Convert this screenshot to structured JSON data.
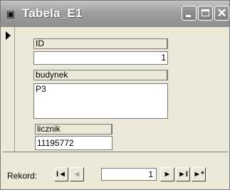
{
  "window": {
    "title": "Tabela_E1",
    "icons": {
      "system": "form-view-icon",
      "minimize": "minimize-icon",
      "maximize": "maximize-icon",
      "close": "close-icon"
    }
  },
  "form": {
    "fields": [
      {
        "label": "ID",
        "value": "1"
      },
      {
        "label": "budynek",
        "value": "P3"
      },
      {
        "label": "licznik",
        "value": "11195772"
      }
    ]
  },
  "navigation": {
    "label": "Rekord:",
    "current_record": "1",
    "first_glyph": "I◄",
    "prev_glyph": "◄",
    "next_glyph": "►",
    "last_glyph": "►I",
    "new_glyph": "►*"
  }
}
